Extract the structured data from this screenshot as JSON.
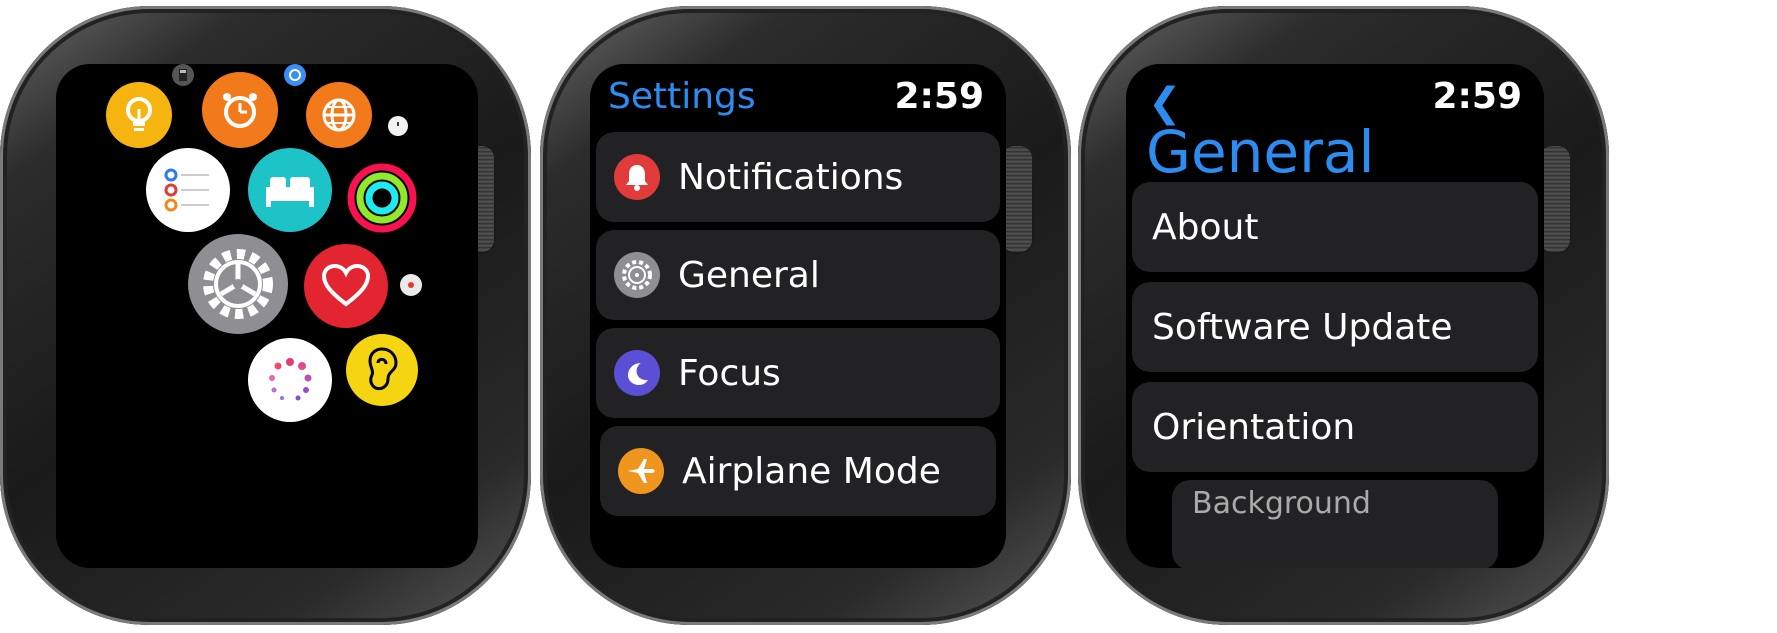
{
  "screen2": {
    "title": "Settings",
    "time": "2:59",
    "items": [
      {
        "label": "Notifications",
        "icon": "bell-icon",
        "color": "#e23b3b"
      },
      {
        "label": "General",
        "icon": "gear-icon",
        "color": "#8e8e93"
      },
      {
        "label": "Focus",
        "icon": "moon-icon",
        "color": "#5b4fd6"
      },
      {
        "label": "Airplane Mode",
        "icon": "airplane-icon",
        "color": "#f0961f"
      }
    ]
  },
  "screen3": {
    "time": "2:59",
    "title": "General",
    "items": [
      {
        "label": "About"
      },
      {
        "label": "Software Update"
      },
      {
        "label": "Orientation"
      },
      {
        "label": "Background"
      }
    ]
  },
  "accent_color": "#2d8cf0"
}
